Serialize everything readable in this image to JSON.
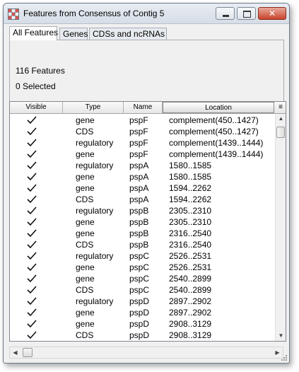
{
  "window": {
    "title": "Features from Consensus of Contig 5",
    "close_glyph": "✕"
  },
  "tabs": [
    {
      "label": "All Features",
      "active": true
    },
    {
      "label": "Genes",
      "active": false
    },
    {
      "label": "CDSs and ncRNAs",
      "active": false
    }
  ],
  "summary": {
    "feature_count": "116 Features",
    "selected_count": "0 Selected"
  },
  "table": {
    "columns": [
      "Visible",
      "Type",
      "Name",
      "Location"
    ],
    "sorted_column": "Location",
    "menu_glyph": "≡",
    "rows": [
      {
        "visible": true,
        "type": "gene",
        "name": "pspF",
        "location": "complement(450..1427)"
      },
      {
        "visible": true,
        "type": "CDS",
        "name": "pspF",
        "location": "complement(450..1427)"
      },
      {
        "visible": true,
        "type": "regulatory",
        "name": "pspF",
        "location": "complement(1439..1444)"
      },
      {
        "visible": true,
        "type": "gene",
        "name": "pspF",
        "location": "complement(1439..1444)"
      },
      {
        "visible": true,
        "type": "regulatory",
        "name": "pspA",
        "location": "1580..1585"
      },
      {
        "visible": true,
        "type": "gene",
        "name": "pspA",
        "location": "1580..1585"
      },
      {
        "visible": true,
        "type": "gene",
        "name": "pspA",
        "location": "1594..2262"
      },
      {
        "visible": true,
        "type": "CDS",
        "name": "pspA",
        "location": "1594..2262"
      },
      {
        "visible": true,
        "type": "regulatory",
        "name": "pspB",
        "location": "2305..2310"
      },
      {
        "visible": true,
        "type": "gene",
        "name": "pspB",
        "location": "2305..2310"
      },
      {
        "visible": true,
        "type": "gene",
        "name": "pspB",
        "location": "2316..2540"
      },
      {
        "visible": true,
        "type": "CDS",
        "name": "pspB",
        "location": "2316..2540"
      },
      {
        "visible": true,
        "type": "regulatory",
        "name": "pspC",
        "location": "2526..2531"
      },
      {
        "visible": true,
        "type": "gene",
        "name": "pspC",
        "location": "2526..2531"
      },
      {
        "visible": true,
        "type": "gene",
        "name": "pspC",
        "location": "2540..2899"
      },
      {
        "visible": true,
        "type": "CDS",
        "name": "pspC",
        "location": "2540..2899"
      },
      {
        "visible": true,
        "type": "regulatory",
        "name": "pspD",
        "location": "2897..2902"
      },
      {
        "visible": true,
        "type": "gene",
        "name": "pspD",
        "location": "2897..2902"
      },
      {
        "visible": true,
        "type": "gene",
        "name": "pspD",
        "location": "2908..3129"
      },
      {
        "visible": true,
        "type": "CDS",
        "name": "pspD",
        "location": "2908..3129"
      }
    ]
  },
  "scrollbars": {
    "up_glyph": "▲",
    "down_glyph": "▼",
    "left_glyph": "◀",
    "right_glyph": "▶"
  }
}
